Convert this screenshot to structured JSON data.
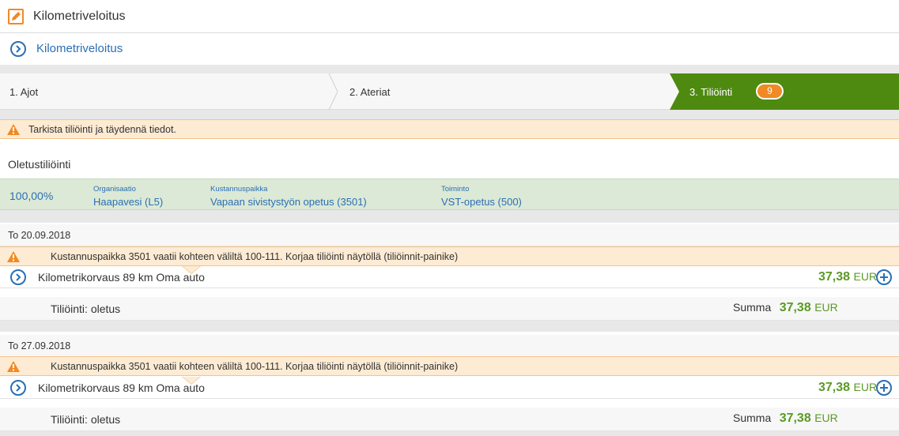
{
  "header": {
    "title": "Kilometriveloitus",
    "icon": "edit-icon"
  },
  "sub_link": {
    "label": "Kilometriveloitus",
    "icon": "chevron-right-circle-icon"
  },
  "steps": [
    {
      "label": "1. Ajot"
    },
    {
      "label": "2. Ateriat"
    },
    {
      "label": "3. Tiliöinti",
      "badge": "9",
      "active": true
    }
  ],
  "top_warning": "Tarkista tiliöinti ja täydennä tiedot.",
  "default_posting": {
    "title": "Oletustiliöinti",
    "percent": "100,00%",
    "fields": [
      {
        "label": "Organisaatio",
        "value": "Haapavesi (L5)"
      },
      {
        "label": "Kustannuspaikka",
        "value": "Vapaan sivistystyön opetus (3501)"
      },
      {
        "label": "Toiminto",
        "value": "VST-opetus (500)"
      }
    ]
  },
  "entries": [
    {
      "date": "To 20.09.2018",
      "warning": "Kustannuspaikka 3501 vaatii kohteen väliltä 100-111. Korjaa tiliöinti näytöllä (tiliöinnit-painike)",
      "item": "Kilometrikorvaus 89 km Oma auto",
      "amount": "37,38",
      "currency": "EUR",
      "posting": "Tiliöinti: oletus",
      "sum_label": "Summa",
      "sum_amount": "37,38",
      "sum_currency": "EUR"
    },
    {
      "date": "To 27.09.2018",
      "warning": "Kustannuspaikka 3501 vaatii kohteen väliltä 100-111. Korjaa tiliöinti näytöllä (tiliöinnit-painike)",
      "item": "Kilometrikorvaus 89 km Oma auto",
      "amount": "37,38",
      "currency": "EUR",
      "posting": "Tiliöinti: oletus",
      "sum_label": "Summa",
      "sum_amount": "37,38",
      "sum_currency": "EUR"
    }
  ],
  "colors": {
    "accent_orange": "#f08a24",
    "link_blue": "#2a6fb5",
    "active_step_green": "#4f8a10",
    "amount_green": "#5a9a24",
    "warning_bg": "#fdebd3",
    "default_box_bg": "#dce9d6"
  }
}
